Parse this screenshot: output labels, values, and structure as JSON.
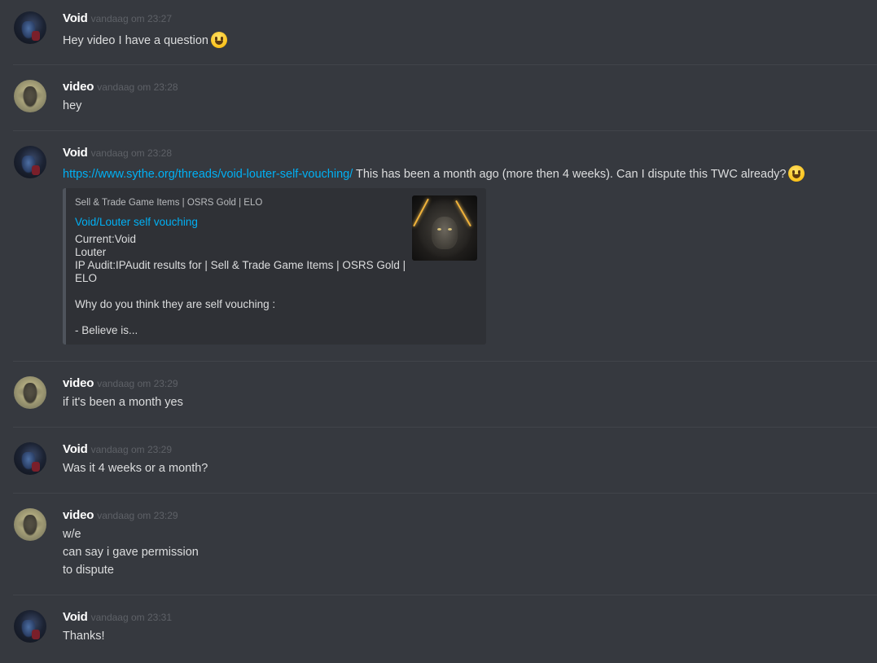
{
  "messages": [
    {
      "author": "Void",
      "timestamp": "vandaag om 23:27",
      "lines": [
        "Hey video I have a question"
      ],
      "emoji": "grinning-face-emoji"
    },
    {
      "author": "video",
      "timestamp": "vandaag om 23:28",
      "lines": [
        "hey"
      ]
    },
    {
      "author": "Void",
      "timestamp": "vandaag om 23:28",
      "link": "https://www.sythe.org/threads/void-louter-self-vouching/",
      "text_after_link": " This has been a month ago (more then 4 weeks). Can I dispute this TWC already?",
      "emoji": "smiley-face-emoji",
      "embed": {
        "provider": "Sell & Trade Game Items | OSRS Gold | ELO",
        "title": "Void/Louter self vouching",
        "description": [
          "Current:Void",
          "Louter",
          "IP Audit:IPAudit results for | Sell & Trade Game Items | OSRS Gold |",
          "ELO",
          "",
          "Why do you think they are self vouching :",
          "",
          "- Believe is..."
        ],
        "thumbnail": "lion-thumbnail-image"
      }
    },
    {
      "author": "video",
      "timestamp": "vandaag om 23:29",
      "lines": [
        "if it's been a month yes"
      ]
    },
    {
      "author": "Void",
      "timestamp": "vandaag om 23:29",
      "lines": [
        "Was it 4 weeks or a month?"
      ]
    },
    {
      "author": "video",
      "timestamp": "vandaag om 23:29",
      "lines": [
        "w/e",
        "can say i gave permission",
        "to dispute"
      ]
    },
    {
      "author": "Void",
      "timestamp": "vandaag om 23:31",
      "lines": [
        "Thanks!"
      ]
    }
  ],
  "colors": {
    "background": "#36393f",
    "link": "#00b0f4",
    "username": "#ffffff",
    "timestamp": "#5e6167",
    "embed_bg": "#2f3136",
    "embed_border": "#4f545c"
  }
}
